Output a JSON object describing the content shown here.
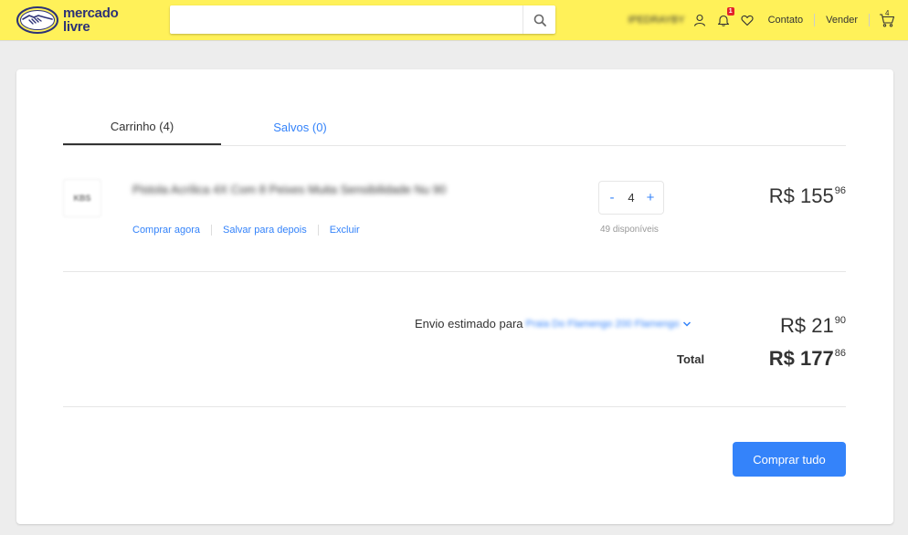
{
  "header": {
    "logo_line1": "mercado",
    "logo_line2": "livre",
    "search_placeholder": "",
    "user_name": "IPEDRAYBY",
    "notifications_count": "1",
    "contact_label": "Contato",
    "sell_label": "Vender",
    "cart_count": "4"
  },
  "tabs": [
    {
      "label": "Carrinho (4)",
      "active": true
    },
    {
      "label": "Salvos (0)",
      "active": false
    }
  ],
  "item": {
    "thumb_text": "KBS",
    "title": "Pistola Acrílica 4X Com 8 Peixes Muita Sensibilidade Nu 90",
    "actions": [
      "Comprar agora",
      "Salvar para depois",
      "Excluir"
    ],
    "quantity": "4",
    "decrement": "-",
    "increment": "+",
    "stock": "49 disponíveis",
    "price_main": "R$ 155",
    "price_cents": "96"
  },
  "summary": {
    "shipping_label": "Envio estimado para",
    "shipping_place": "Praia Do Flamengo 200 Flamengo",
    "shipping_price_main": "R$ 21",
    "shipping_price_cents": "90",
    "total_label": "Total",
    "total_main": "R$ 177",
    "total_cents": "86"
  },
  "buy_all_label": "Comprar tudo",
  "colors": {
    "header_bg": "#fff159",
    "accent": "#3483fa",
    "brand_blue": "#2d3277"
  }
}
